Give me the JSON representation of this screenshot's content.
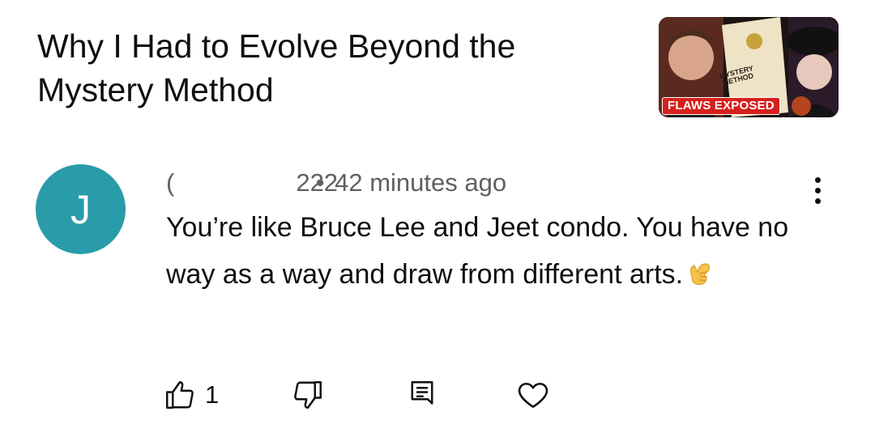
{
  "video": {
    "title": "Why I Had to Evolve Beyond the Mystery Method",
    "thumbnail_badge": "FLAWS EXPOSED",
    "thumbnail_book_title": "MYSTERY METHOD"
  },
  "comment": {
    "avatar_letter": "J",
    "author_fragment_start": "(",
    "author_fragment_end": "222",
    "separator": "•",
    "time": "42 minutes ago",
    "text": "You’re like Bruce Lee and Jeet condo. You have no way as a way and draw from different arts.",
    "like_count": "1"
  },
  "icons": {
    "more": "more-vertical-icon",
    "like": "thumb-up-icon",
    "dislike": "thumb-down-icon",
    "reply": "reply-icon",
    "heart": "heart-icon",
    "emoji": "call-me-hand-emoji"
  },
  "colors": {
    "avatar": "#2a9ba9",
    "badge": "#d6201c",
    "meta_text": "#606060"
  }
}
